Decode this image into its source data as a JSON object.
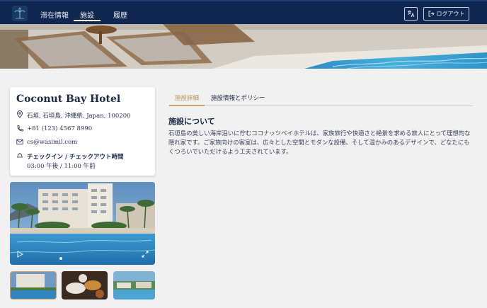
{
  "nav": {
    "items": [
      {
        "label": "滞在情報",
        "active": false
      },
      {
        "label": "施設",
        "active": true
      },
      {
        "label": "履歴",
        "active": false
      }
    ],
    "translate_icon": "translate-icon",
    "logout_label": "ログアウト",
    "logout_icon": "logout-icon"
  },
  "hotel": {
    "name": "Coconut Bay Hotel",
    "address": "石垣, 石垣島, 沖縄県, Japan, 100200",
    "phone": "+81 (123) 4567 8990",
    "email": "cs@wasimil.com",
    "checkin_label": "チェックイン / チェックアウト時間",
    "checkin_time": "03:00 午後 / 11:00 午前"
  },
  "gallery": {
    "active_index": 0,
    "thumb_count": 3
  },
  "tabs": [
    {
      "label": "施設詳細",
      "active": true
    },
    {
      "label": "施設情報とポリシー",
      "active": false
    }
  ],
  "about": {
    "title": "施設について",
    "text": "石垣島の美しい海岸沿いに佇むココナッツベイホテルは、家族旅行や快適さと絶景を求める旅人にとって理想的な隠れ家です。ご家族向けの客室は、広々とした空間とモダンな設備、そして温かみのあるデザインで、どなたにもくつろいでいただけるよう工夫されています。"
  },
  "colors": {
    "navy": "#0f2751",
    "accent_gold": "#c9a46b",
    "background": "#f1f1f1"
  }
}
